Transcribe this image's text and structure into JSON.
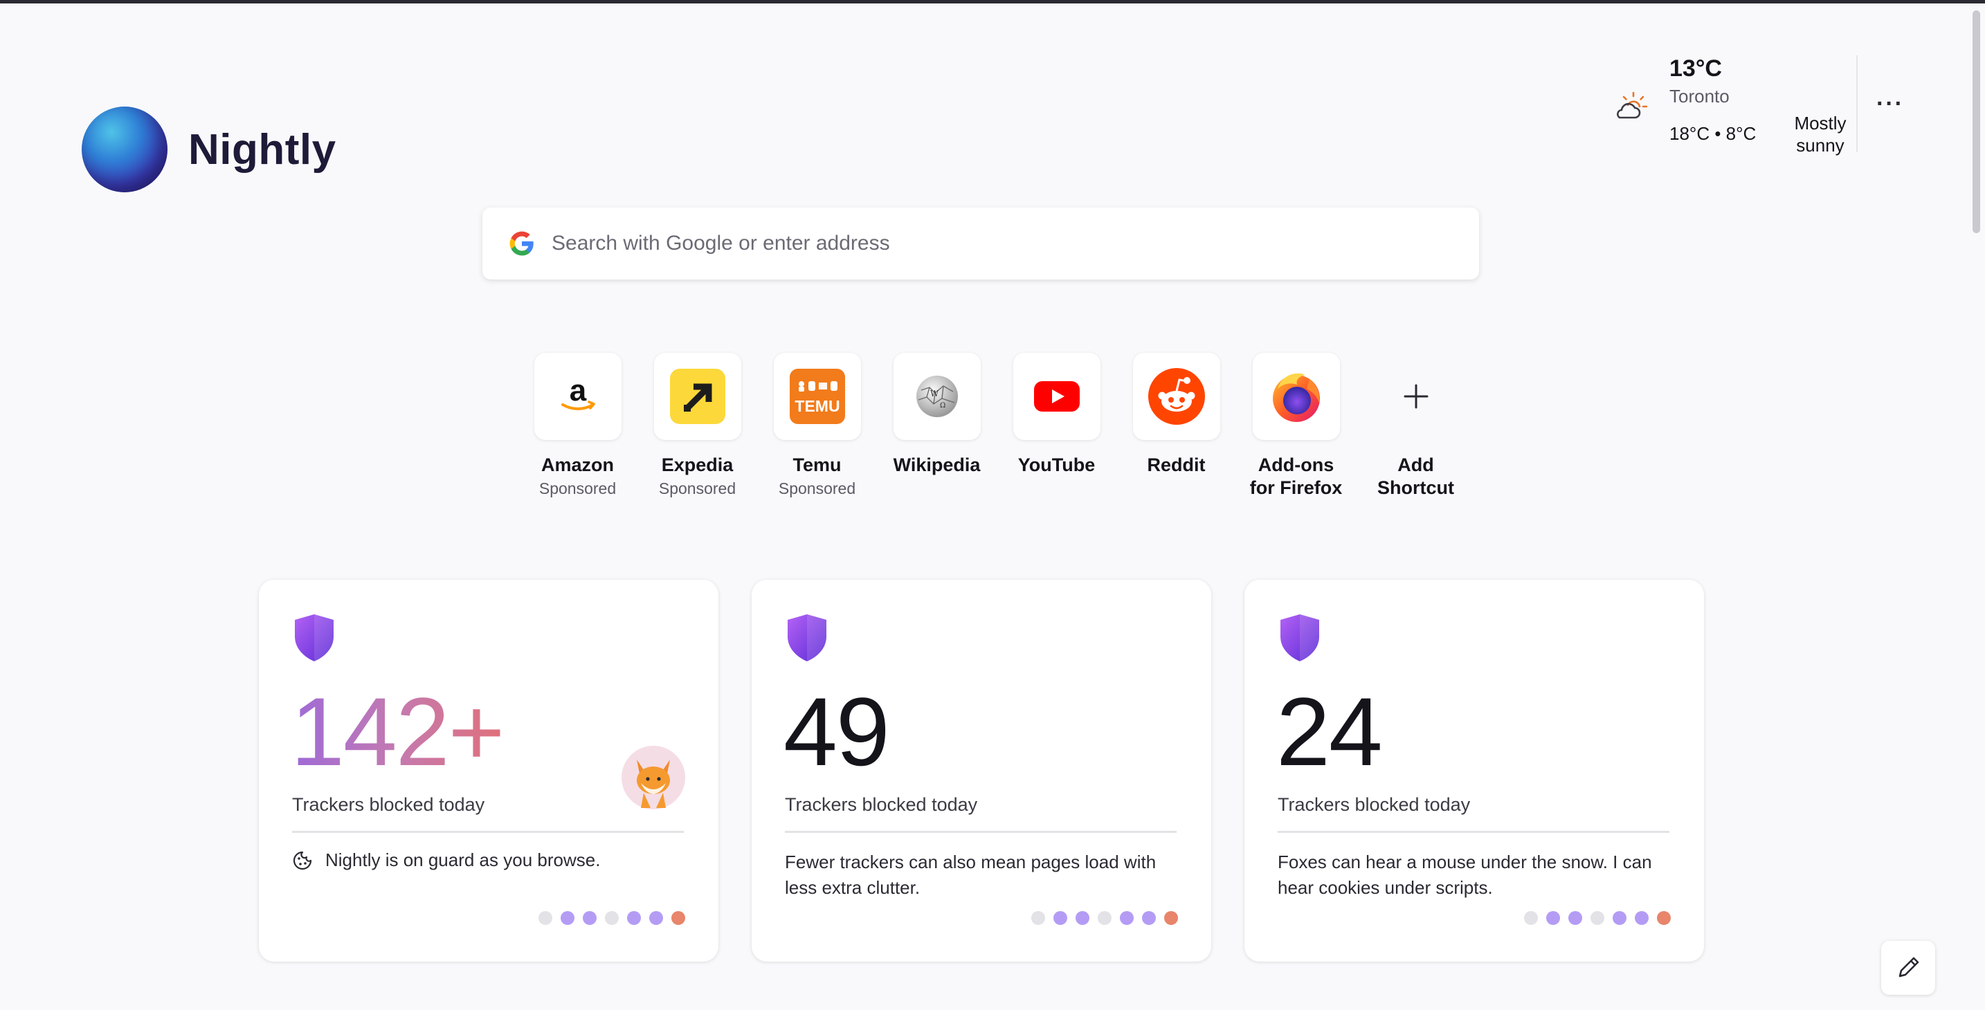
{
  "brand": {
    "name": "Nightly"
  },
  "weather": {
    "temperature": "13°C",
    "city": "Toronto",
    "range": "18°C • 8°C",
    "condition": "Mostly sunny",
    "icon": "partly-sunny-icon"
  },
  "menu": {
    "more_label": "···"
  },
  "search": {
    "placeholder": "Search with Google or enter address"
  },
  "shortcuts": [
    {
      "label": "Amazon",
      "sub": "Sponsored",
      "icon": "amazon-icon"
    },
    {
      "label": "Expedia",
      "sub": "Sponsored",
      "icon": "expedia-icon"
    },
    {
      "label": "Temu",
      "sub": "Sponsored",
      "icon": "temu-icon"
    },
    {
      "label": "Wikipedia",
      "sub": "",
      "icon": "wikipedia-icon"
    },
    {
      "label": "YouTube",
      "sub": "",
      "icon": "youtube-icon"
    },
    {
      "label": "Reddit",
      "sub": "",
      "icon": "reddit-icon"
    },
    {
      "label": "Add-ons for Firefox",
      "sub": "",
      "icon": "firefox-icon"
    },
    {
      "label": "Add Shortcut",
      "sub": "",
      "icon": "plus-icon"
    }
  ],
  "cards": [
    {
      "count": "142+",
      "label": "Trackers blocked today",
      "message": "Nightly is on guard as you browse."
    },
    {
      "count": "49",
      "label": "Trackers blocked today",
      "message": "Fewer trackers can also mean pages load with less extra clutter."
    },
    {
      "count": "24",
      "label": "Trackers blocked today",
      "message": "Foxes can hear a mouse under the snow. I can hear cookies under scripts."
    }
  ],
  "colors": {
    "dot_inactive": "#e2e2e7",
    "dot_purple": "#b49cf5",
    "dot_active": "#e8856a",
    "shield_top": "#a855f7",
    "shield_bottom": "#6d28d9"
  }
}
